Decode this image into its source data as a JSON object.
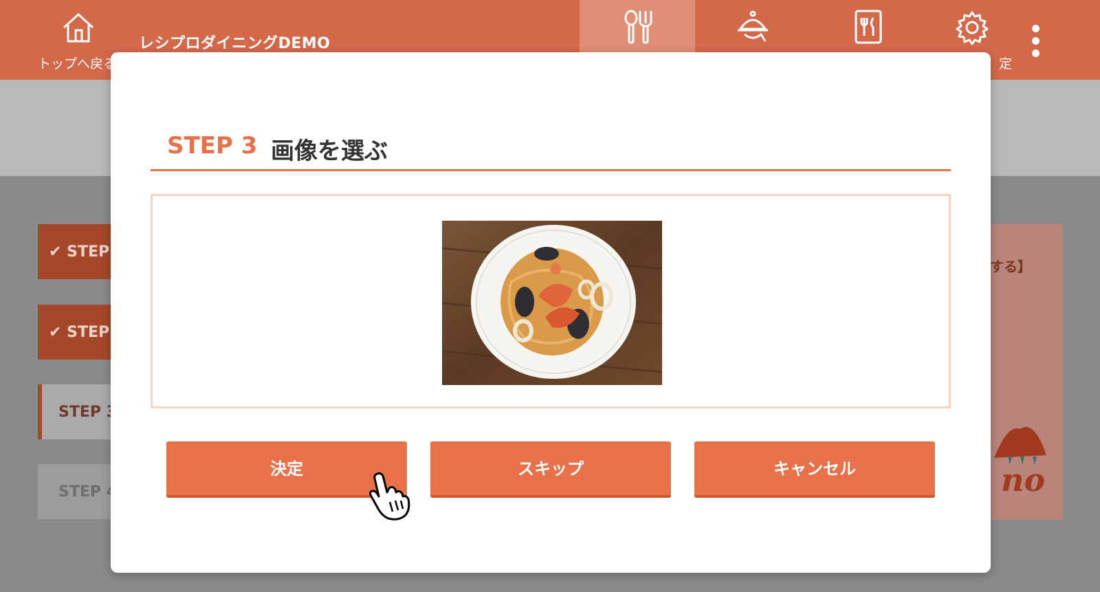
{
  "header": {
    "home_label": "トップへ戻る",
    "app_title": "レシプロダイニングDEMO",
    "tabs": [
      {
        "icon": "utensils-icon",
        "label": ""
      },
      {
        "icon": "cloche-icon",
        "label": ""
      },
      {
        "icon": "menu-book-icon",
        "label": ""
      },
      {
        "icon": "gear-icon",
        "label": "定"
      }
    ]
  },
  "sidebar": {
    "steps": [
      {
        "label": "✔ STEP",
        "state": "done"
      },
      {
        "label": "✔ STEP",
        "state": "done"
      },
      {
        "label": "STEP 3",
        "state": "current"
      },
      {
        "label": "STEP 4",
        "state": "future"
      }
    ]
  },
  "right_panel": {
    "hint": "する】",
    "logo_text": "no"
  },
  "modal": {
    "step_label": "STEP 3",
    "step_title": "画像を選ぶ",
    "image_alt": "seafood-pasta-photo",
    "buttons": {
      "decide": "決定",
      "skip": "スキップ",
      "cancel": "キャンセル"
    }
  },
  "colors": {
    "accent": "#e9714a",
    "header_bg": "#d4694a",
    "overlay_grey": "#8a8a8a"
  }
}
